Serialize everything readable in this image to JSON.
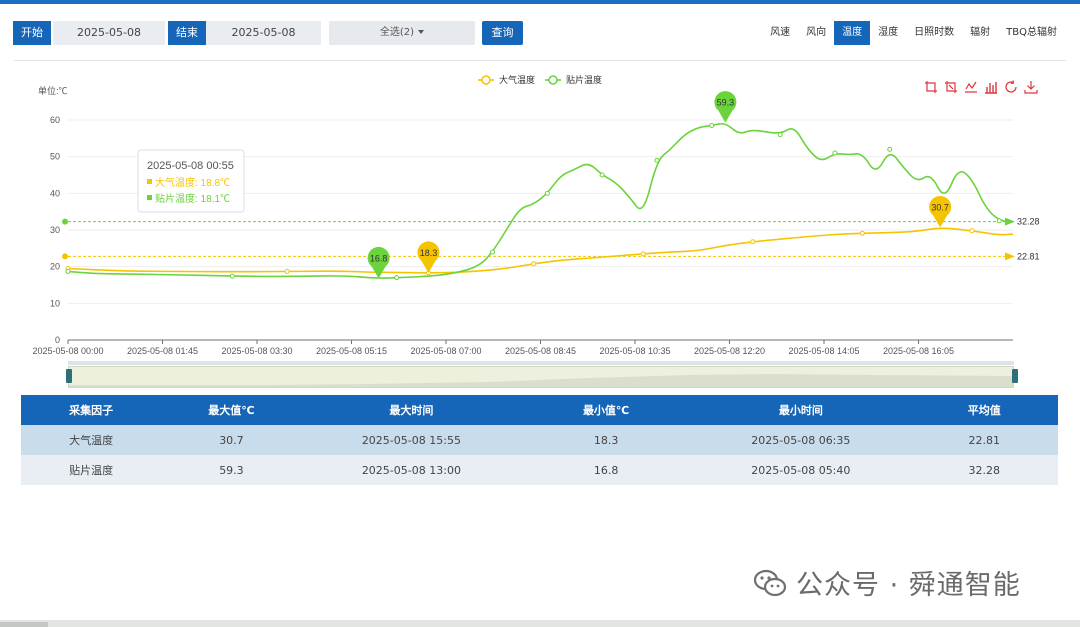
{
  "toolbar": {
    "start_label": "开始",
    "start_date": "2025-05-08",
    "end_label": "结束",
    "end_date": "2025-05-08",
    "select_value": "全选(2)",
    "query_label": "查询"
  },
  "tabs": [
    {
      "label": "风速",
      "active": false
    },
    {
      "label": "风向",
      "active": false
    },
    {
      "label": "温度",
      "active": true
    },
    {
      "label": "湿度",
      "active": false
    },
    {
      "label": "日照时数",
      "active": false
    },
    {
      "label": "辐射",
      "active": false
    },
    {
      "label": "TBQ总辐射",
      "active": false
    }
  ],
  "toolbox_icons": [
    "zoom-icon",
    "zoom-reset-icon",
    "line-chart-icon",
    "bar-chart-icon",
    "restore-icon",
    "download-icon"
  ],
  "chart_data": {
    "type": "line",
    "unit_label": "单位:℃",
    "x_ticks": [
      "2025-05-08 00:00",
      "2025-05-08 01:45",
      "2025-05-08 03:30",
      "2025-05-08 05:15",
      "2025-05-08 07:00",
      "2025-05-08 08:45",
      "2025-05-08 10:35",
      "2025-05-08 12:20",
      "2025-05-08 14:05",
      "2025-05-08 16:05"
    ],
    "x_range_hours": [
      0,
      17.25
    ],
    "y_ticks": [
      0,
      10,
      20,
      30,
      40,
      50,
      60
    ],
    "ylim": [
      0,
      60
    ],
    "legend_position": "top-center",
    "series": [
      {
        "name": "大气温度",
        "color": "#f5c400",
        "x_hours": [
          0,
          1,
          2,
          3,
          4,
          5,
          5.5,
          6,
          6.58,
          7,
          7.5,
          8,
          8.5,
          9,
          9.5,
          10,
          10.5,
          11,
          11.5,
          12,
          12.5,
          13,
          13.5,
          14,
          14.5,
          15,
          15.5,
          15.92,
          16.5,
          17,
          17.25
        ],
        "values": [
          19.5,
          18.8,
          18.7,
          18.6,
          18.7,
          18.8,
          18.5,
          18.4,
          18.3,
          18.4,
          18.8,
          19.5,
          20.8,
          21.8,
          22.3,
          22.9,
          23.5,
          24.0,
          24.3,
          25.8,
          26.8,
          27.5,
          28.2,
          28.8,
          29.1,
          29.3,
          29.6,
          30.7,
          29.8,
          28.6,
          28.9
        ],
        "max": {
          "value": 30.7,
          "x_hours": 15.92
        },
        "min": {
          "value": 18.3,
          "x_hours": 6.58
        },
        "average": 22.81
      },
      {
        "name": "贴片温度",
        "color": "#6bd33b",
        "x_hours": [
          0,
          0.5,
          1,
          2,
          3,
          4,
          5,
          5.67,
          6,
          6.5,
          7,
          7.5,
          7.75,
          8,
          8.25,
          8.5,
          8.75,
          9,
          9.25,
          9.5,
          9.75,
          10,
          10.25,
          10.5,
          10.75,
          11,
          11.25,
          11.5,
          11.75,
          12,
          12.25,
          12.5,
          13,
          13.25,
          13.5,
          13.75,
          14,
          14.25,
          14.5,
          14.75,
          15,
          15.25,
          15.5,
          15.75,
          16,
          16.25,
          16.5,
          16.75,
          17,
          17.25
        ],
        "values": [
          18.7,
          18.1,
          18.0,
          17.8,
          17.4,
          17.3,
          17.6,
          16.8,
          17.0,
          17.3,
          18.0,
          20.0,
          24.0,
          30.0,
          36.0,
          37.0,
          40.0,
          45.0,
          46.5,
          48.5,
          45.0,
          43.0,
          39.0,
          34.0,
          49.0,
          52.0,
          56.0,
          58.0,
          58.5,
          59.3,
          56.0,
          57.5,
          56.0,
          58.5,
          52.0,
          48.5,
          51.0,
          50.5,
          51.0,
          45.0,
          52.0,
          47.0,
          43.0,
          45.5,
          38.0,
          47.0,
          44.0,
          36.0,
          32.5,
          32.28
        ],
        "max": {
          "value": 59.3,
          "x_hours": 12.0
        },
        "min": {
          "value": 16.8,
          "x_hours": 5.67
        },
        "average": 32.28
      }
    ],
    "avg_labels": {
      "atmos": "22.81",
      "patch": "32.28"
    },
    "markers": {
      "atmos_max": "30.7",
      "atmos_min": "18.3",
      "patch_max": "59.3",
      "patch_min": "16.8"
    },
    "tooltip": {
      "time": "2025-05-08 00:55",
      "line1": "大气温度: 18.8℃",
      "line2": "贴片温度: 18.1℃"
    },
    "zoom": {
      "start_percent": 0,
      "end_percent": 100
    }
  },
  "table": {
    "headers": [
      "采集因子",
      "最大值℃",
      "最大时间",
      "最小值℃",
      "最小时间",
      "平均值"
    ],
    "rows": [
      [
        "大气温度",
        "30.7",
        "2025-05-08 15:55",
        "18.3",
        "2025-05-08 06:35",
        "22.81"
      ],
      [
        "贴片温度",
        "59.3",
        "2025-05-08 13:00",
        "16.8",
        "2025-05-08 05:40",
        "32.28"
      ]
    ]
  },
  "watermark": {
    "text": "公众号 · 舜通智能"
  }
}
